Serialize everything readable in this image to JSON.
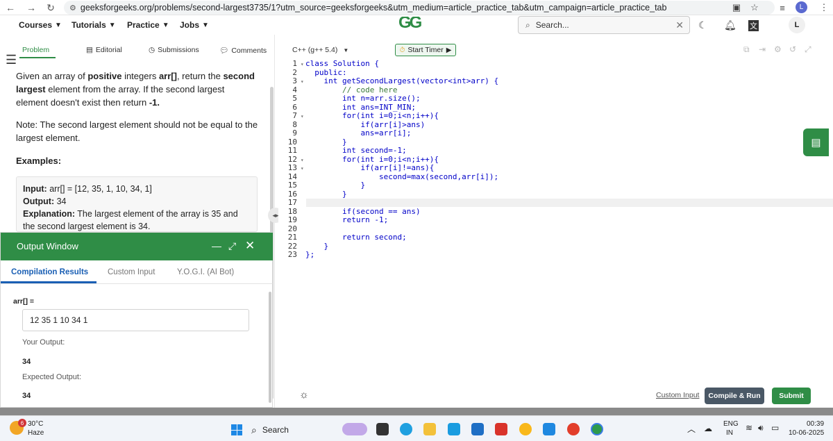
{
  "browser": {
    "url": "geeksforgeeks.org/problems/second-largest3735/1?utm_source=geeksforgeeks&utm_medium=article_practice_tab&utm_campaign=article_practice_tab",
    "profile_initial": "L"
  },
  "header": {
    "nav": [
      "Courses",
      "Tutorials",
      "Practice",
      "Jobs"
    ],
    "logo": "GG",
    "search_placeholder": "Search...",
    "user_initial": "L"
  },
  "problem_tabs": [
    "Problem",
    "Editorial",
    "Submissions",
    "Comments"
  ],
  "problem": {
    "statement_parts": [
      "Given an array of ",
      "positive",
      " integers ",
      "arr[]",
      ", return the ",
      "second",
      " ",
      "largest",
      " element from the array. If the second largest element doesn't exist then return ",
      "-1."
    ],
    "note": "Note: The second largest element should not be equal to the largest element.",
    "examples_heading": "Examples:",
    "example": {
      "input_label": "Input:",
      "input_value": "arr[] = [12, 35, 1, 10, 34, 1]",
      "output_label": "Output:",
      "output_value": "34",
      "explanation_label": "Explanation:",
      "explanation_text": "The largest element of the array is 35 and the second largest element is 34."
    }
  },
  "output_window": {
    "title": "Output Window",
    "tabs": [
      "Compilation Results",
      "Custom Input",
      "Y.O.G.I. (AI Bot)"
    ],
    "arr_label": "arr[] =",
    "arr_value": "12 35 1 10 34 1",
    "your_output_label": "Your Output:",
    "your_output_value": "34",
    "expected_output_label": "Expected Output:",
    "expected_output_value": "34"
  },
  "editor": {
    "language": "C++ (g++ 5.4)",
    "start_timer": "Start Timer",
    "code_lines": [
      "class Solution {",
      "  public:",
      "    int getSecondLargest(vector<int>arr) {",
      "        // code here",
      "        int n=arr.size();",
      "        int ans=INT_MIN;",
      "        for(int i=0;i<n;i++){",
      "            if(arr[i]>ans)",
      "            ans=arr[i];",
      "        }",
      "        int second=-1;",
      "        for(int i=0;i<n;i++){",
      "            if(arr[i]!=ans){",
      "                second=max(second,arr[i]);",
      "            }",
      "        }",
      "",
      "        if(second == ans)",
      "        return -1;",
      "",
      "        return second;",
      "    }",
      "};"
    ],
    "fold_lines": [
      1,
      3,
      7,
      12,
      13
    ],
    "custom_input": "Custom Input",
    "compile_run": "Compile & Run",
    "submit": "Submit"
  },
  "taskbar": {
    "weather_badge": "6",
    "temperature": "30°C",
    "condition": "Haze",
    "search": "Search",
    "lang_top": "ENG",
    "lang_bottom": "IN",
    "time": "00:39",
    "date": "10-06-2025"
  }
}
